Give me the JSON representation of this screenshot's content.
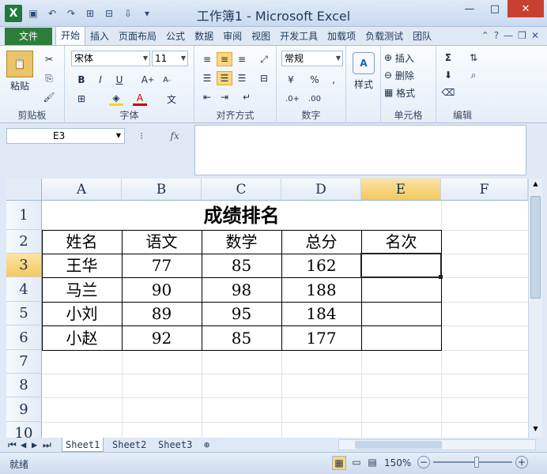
{
  "window": {
    "title": "工作簿1 - Microsoft Excel"
  },
  "tabs": [
    "文件",
    "开始",
    "插入",
    "页面布局",
    "公式",
    "数据",
    "审阅",
    "视图",
    "开发工具",
    "加载项",
    "负载测试",
    "团队"
  ],
  "ribbon": {
    "clipboard": {
      "paste": "粘贴",
      "label": "剪贴板"
    },
    "font": {
      "name": "宋体",
      "size": "11",
      "label": "字体"
    },
    "alignment": {
      "label": "对齐方式"
    },
    "number": {
      "format": "常规",
      "label": "数字"
    },
    "styles": {
      "styles": "样式"
    },
    "cells": {
      "insert": "插入",
      "delete": "删除",
      "format": "格式",
      "label": "单元格"
    },
    "editing": {
      "label": "编辑"
    }
  },
  "formula_bar": {
    "name_box": "E3",
    "fx": "fx",
    "value": ""
  },
  "grid": {
    "columns": [
      "A",
      "B",
      "C",
      "D",
      "E",
      "F"
    ],
    "rows": [
      "1",
      "2",
      "3",
      "4",
      "5",
      "6",
      "7",
      "8",
      "9",
      "10"
    ],
    "title": "成绩排名",
    "headers": [
      "姓名",
      "语文",
      "数学",
      "总分",
      "名次"
    ],
    "data": [
      [
        "王华",
        "77",
        "85",
        "162",
        ""
      ],
      [
        "马兰",
        "90",
        "98",
        "188",
        ""
      ],
      [
        "小刘",
        "89",
        "95",
        "184",
        ""
      ],
      [
        "小赵",
        "92",
        "85",
        "177",
        ""
      ]
    ],
    "active_cell": "E3"
  },
  "sheets": [
    "Sheet1",
    "Sheet2",
    "Sheet3"
  ],
  "status": {
    "ready": "就绪",
    "zoom": "150%"
  }
}
